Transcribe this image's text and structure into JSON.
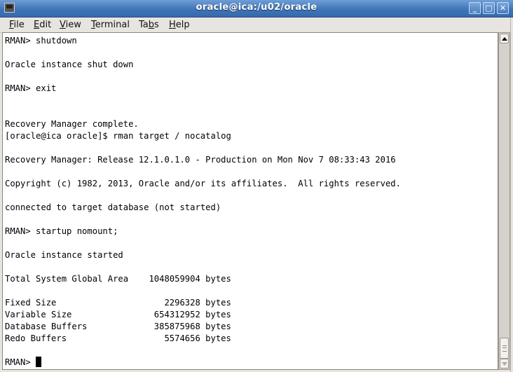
{
  "window": {
    "title": "oracle@ica:/u02/oracle",
    "controls": {
      "minimize": "_",
      "maximize": "□",
      "close": "✕"
    }
  },
  "menubar": {
    "items": [
      {
        "label_pre": "",
        "label_u": "F",
        "label_post": "ile"
      },
      {
        "label_pre": "",
        "label_u": "E",
        "label_post": "dit"
      },
      {
        "label_pre": "",
        "label_u": "V",
        "label_post": "iew"
      },
      {
        "label_pre": "",
        "label_u": "T",
        "label_post": "erminal"
      },
      {
        "label_pre": "Ta",
        "label_u": "b",
        "label_post": "s"
      },
      {
        "label_pre": "",
        "label_u": "H",
        "label_post": "elp"
      }
    ]
  },
  "terminal": {
    "lines": [
      "RMAN> shutdown",
      "",
      "Oracle instance shut down",
      "",
      "RMAN> exit",
      "",
      "",
      "Recovery Manager complete.",
      "[oracle@ica oracle]$ rman target / nocatalog",
      "",
      "Recovery Manager: Release 12.1.0.1.0 - Production on Mon Nov 7 08:33:43 2016",
      "",
      "Copyright (c) 1982, 2013, Oracle and/or its affiliates.  All rights reserved.",
      "",
      "connected to target database (not started)",
      "",
      "RMAN> startup nomount;",
      "",
      "Oracle instance started",
      "",
      "Total System Global Area    1048059904 bytes",
      "",
      "Fixed Size                     2296328 bytes",
      "Variable Size                654312952 bytes",
      "Database Buffers             385875968 bytes",
      "Redo Buffers                   5574656 bytes",
      "",
      "RMAN> "
    ],
    "prompt_line_index": 27
  }
}
